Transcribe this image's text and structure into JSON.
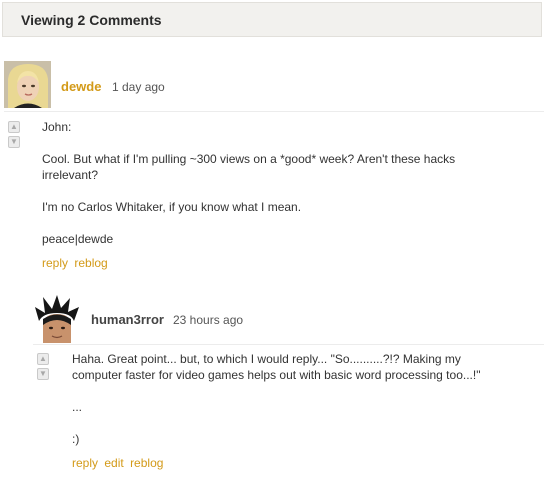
{
  "header": {
    "title": "Viewing 2 Comments"
  },
  "colors": {
    "accent": "#d39a18",
    "author_dark": "#444444"
  },
  "comments": [
    {
      "author": "dewde",
      "time": "1 day ago",
      "paragraphs": [
        "John:",
        "Cool. But what if I'm pulling ~300 views on a *good* week? Aren't these hacks irrelevant?",
        "I'm no Carlos Whitaker, if you know what I mean.",
        "peace|dewde"
      ],
      "actions": {
        "reply": "reply",
        "reblog": "reblog"
      },
      "vote_up_icon": "thumb-up-icon",
      "vote_down_icon": "thumb-down-icon"
    },
    {
      "author": "human3rror",
      "time": "23 hours ago",
      "paragraphs": [
        "Haha. Great point... but, to which I would reply... \"So..........?!? Making my computer faster for video games helps out with basic word processing too...!\"",
        "...",
        ":)"
      ],
      "actions": {
        "reply": "reply",
        "edit": "edit",
        "reblog": "reblog"
      },
      "vote_up_icon": "thumb-up-icon",
      "vote_down_icon": "thumb-down-icon"
    }
  ]
}
